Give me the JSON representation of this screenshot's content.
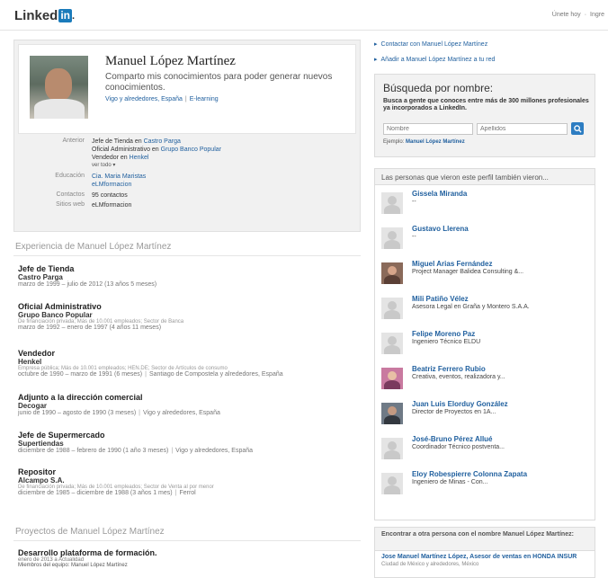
{
  "header": {
    "logo_text": "Linked",
    "logo_in": "in",
    "logo_dot": ".",
    "links": [
      "Únete hoy",
      "Ingre"
    ]
  },
  "profile": {
    "name": "Manuel López Martínez",
    "headline": "Comparto mis conocimientos para poder generar nuevos conocimientos.",
    "location": "Vigo y alrededores, España",
    "industry": "E-learning",
    "details": {
      "previous_label": "Anterior",
      "previous": [
        {
          "role": "Jefe de Tienda en ",
          "company": "Castro Parga"
        },
        {
          "role": "Oficial Administrativo en ",
          "company": "Grupo Banco Popular"
        },
        {
          "role": "Vendedor en ",
          "company": "Henkel"
        }
      ],
      "see_all": "ver todo",
      "education_label": "Educación",
      "education": [
        "Cia. Maria Maristas",
        "eLMformacion"
      ],
      "connections_label": "Contactos",
      "connections": "95 contactos",
      "websites_label": "Sitios web",
      "website": "eLMformacion"
    }
  },
  "experience": {
    "title": "Experiencia de Manuel López Martínez",
    "items": [
      {
        "title": "Jefe de Tienda",
        "company": "Castro Parga",
        "meta": "",
        "date": "marzo de 1999 – julio de 2012 (13 años 5 meses)",
        "place": ""
      },
      {
        "title": "Oficial Administrativo",
        "company": "Grupo Banco Popular",
        "meta": "De financiación privada; Más de 10.001 empleados; Sector de Banca",
        "date": "marzo de 1992 – enero de 1997 (4 años 11 meses)",
        "place": ""
      },
      {
        "title": "Vendedor",
        "company": "Henkel",
        "meta": "Empresa pública; Más de 10.001 empleados; HEN.DE; Sector de Artículos de consumo",
        "date": "octubre de 1990 – marzo de 1991 (6 meses)",
        "place": "Santiago de Compostela y alrededores, España"
      },
      {
        "title": "Adjunto a la dirección comercial",
        "company": "Decogar",
        "meta": "",
        "date": "junio de 1990 – agosto de 1990 (3 meses)",
        "place": "Vigo y alrededores, España"
      },
      {
        "title": "Jefe de Supermercado",
        "company": "Supertiendas",
        "meta": "",
        "date": "diciembre de 1988 – febrero de 1990 (1 año 3 meses)",
        "place": "Vigo y alrededores, España"
      },
      {
        "title": "Repositor",
        "company": "Alcampo S.A.",
        "meta": "De financiación privada; Más de 10.001 empleados; Sector de Venta al por menor",
        "date": "diciembre de 1985 – diciembre de 1988 (3 años 1 mes)",
        "place": "Ferrol"
      }
    ]
  },
  "projects": {
    "title": "Proyectos de Manuel López Martínez",
    "item_title": "Desarrollo plataforma de formación.",
    "item_date": "enero de 2013 a Actualidad",
    "item_members": "Miembros del equipo: Manuel López Martínez"
  },
  "actions": {
    "contact": "Contactar con Manuel López Martínez",
    "add": "Añadir a Manuel López Martínez a tu red"
  },
  "search": {
    "title": "Búsqueda por nombre:",
    "desc": "Busca a gente que conoces entre más de 300 millones profesionales ya incorporados a LinkedIn.",
    "first_placeholder": "Nombre",
    "last_placeholder": "Apellidos",
    "example_label": "Ejemplo:",
    "example_name": "Manuel López Martínez"
  },
  "viewed": {
    "title": "Las personas que vieron este perfil también vieron...",
    "people": [
      {
        "name": "Gissela Miranda",
        "title": "--",
        "photo": "none"
      },
      {
        "name": "Gustavo Llerena",
        "title": "--",
        "photo": "none"
      },
      {
        "name": "Miguel Arias Fernández",
        "title": "Project Manager Balidea Consulting &...",
        "photo": "photo"
      },
      {
        "name": "Mili Patiño Vélez",
        "title": "Asesora Legal en Graña y Montero S.A.A.",
        "photo": "none"
      },
      {
        "name": "Felipe Moreno Paz",
        "title": "Ingeniero Técnico ELDU",
        "photo": "none"
      },
      {
        "name": "Beatriz Ferrero Rubio",
        "title": "Creativa, eventos, realizadora y...",
        "photo": "photo2"
      },
      {
        "name": "Juan Luis Elorduy González",
        "title": "Director de Proyectos en 1A...",
        "photo": "photo3"
      },
      {
        "name": "José-Bruno Pérez Allué",
        "title": "Coordinador Técnico postventa...",
        "photo": "none"
      },
      {
        "name": "Eloy Robespierre Colonna Zapata",
        "title": "Ingeniero de Minas - Con...",
        "photo": "none"
      }
    ]
  },
  "find": {
    "title": "Encontrar a otra persona con el nombre Manuel López Martínez:",
    "person_name": "Jose Manuel Martínez López,",
    "person_role": " Asesor de ventas en HONDA INSUR",
    "person_location": "Ciudad de México y alrededores, México"
  },
  "colors": {
    "link": "#1f5f9e",
    "brand": "#1a7bbb"
  }
}
